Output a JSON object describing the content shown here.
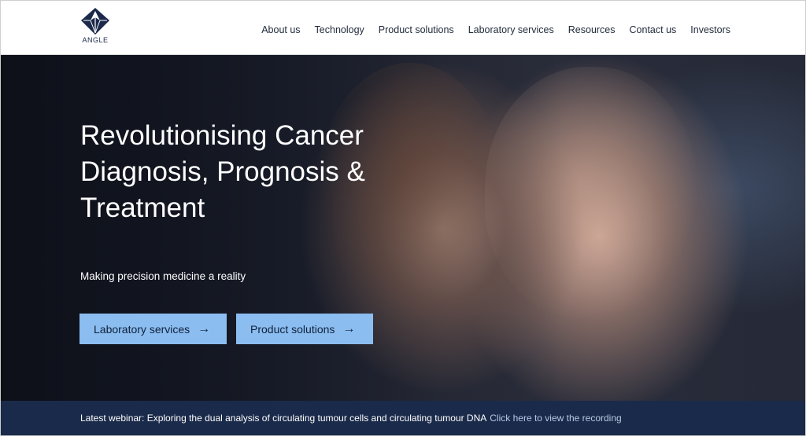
{
  "brand": {
    "name": "ANGLE",
    "color": "#1b2a4a"
  },
  "nav": [
    {
      "label": "About us"
    },
    {
      "label": "Technology"
    },
    {
      "label": "Product solutions"
    },
    {
      "label": "Laboratory services"
    },
    {
      "label": "Resources"
    },
    {
      "label": "Contact us"
    },
    {
      "label": "Investors"
    }
  ],
  "hero": {
    "title": "Revolutionising Cancer Diagnosis, Prognosis & Treatment",
    "subtitle": "Making precision medicine a reality",
    "buttons": [
      {
        "label": "Laboratory services",
        "icon": "arrow-right-icon"
      },
      {
        "label": "Product solutions",
        "icon": "arrow-right-icon"
      }
    ],
    "button_color": "#8bbdf0"
  },
  "banner": {
    "text": "Latest webinar: Exploring the dual analysis of circulating tumour cells and circulating tumour DNA",
    "link": "Click here to view the recording",
    "background": "#1a2a4a"
  }
}
